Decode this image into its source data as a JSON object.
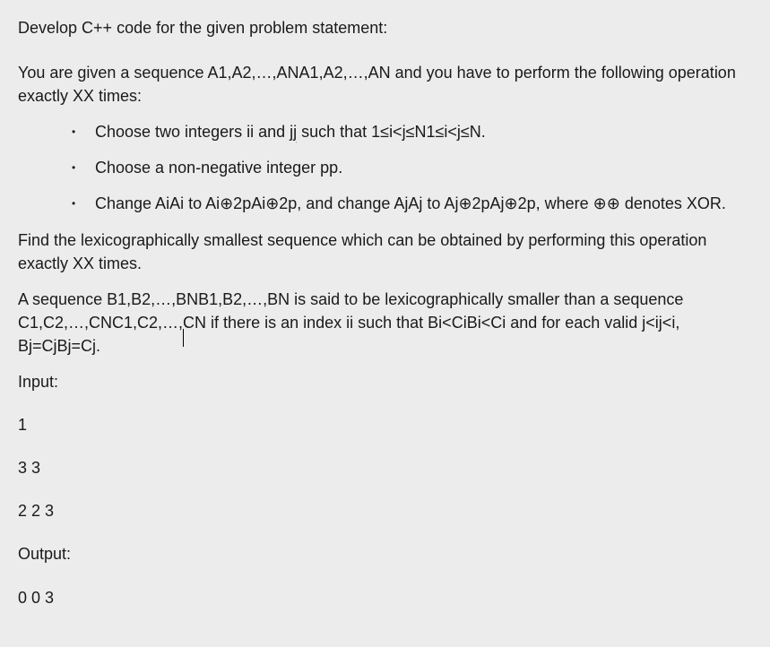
{
  "title": "Develop C++ code for the given problem statement:",
  "desc_prefix": "You are given a sequence A1,A2,…,ANA1,A2,…,AN and you have to perform the following operation exactly XX times:",
  "bullets": {
    "b1_a": "Choose two integers ii and ",
    "b1_jj": "jj",
    "b1_b": " such that 1≤i<j≤N1≤i<j≤N.",
    "b2": "Choose a non-negative integer pp.",
    "b3": "Change AiAi to Ai⊕2pAi⊕2p, and change AjAj to Aj⊕2pAj⊕2p, where ⊕⊕ denotes XOR."
  },
  "find": "Find the lexicographically smallest sequence which can be obtained by performing this operation exactly XX times.",
  "lex_a": "A sequence B1,B2,…,BNB1,B2,…,BN is said to be lexicographically smaller than a sequence C1,C2,…,CNC1,C2,…,",
  "lex_b": "CN if there is an index ii such that Bi<CiBi<Ci and for each valid j<ij<i, Bj=CjBj=Cj.",
  "input_label": "Input:",
  "input_lines": [
    "1",
    "3 3",
    "2 2 3"
  ],
  "output_label": "Output:",
  "output_lines": [
    "0 0 3"
  ]
}
